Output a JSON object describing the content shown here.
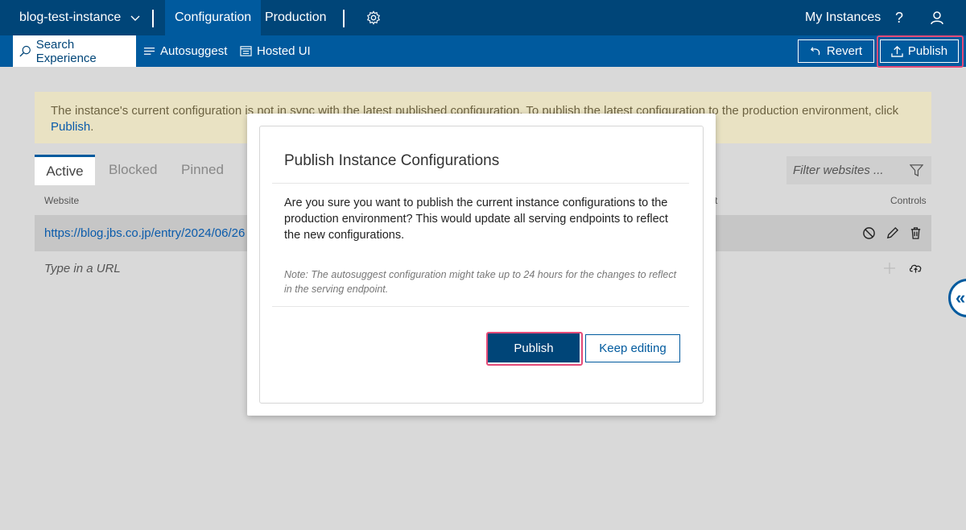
{
  "topbar": {
    "instance_name": "blog-test-instance",
    "tabs": [
      "Configuration",
      "Production"
    ],
    "my_instances": "My Instances",
    "help": "?"
  },
  "subbar": {
    "tabs": [
      "Search Experience",
      "Autosuggest",
      "Hosted UI"
    ],
    "revert_label": "Revert",
    "publish_label": "Publish"
  },
  "banner": {
    "text": "The instance's current configuration is not in sync with the latest published configuration. To publish the latest configuration to the production environment, click",
    "link": "Publish",
    "suffix": "."
  },
  "list": {
    "tabs": [
      "Active",
      "Blocked",
      "Pinned"
    ],
    "filter_placeholder": "Filter websites ...",
    "col_website": "Website",
    "col_right_partial": "t",
    "col_controls": "Controls",
    "rows": [
      {
        "url": "https://blog.jbs.co.jp/entry/2024/06/26"
      }
    ],
    "type_placeholder": "Type in a URL",
    "side_glyph": "«"
  },
  "dialog": {
    "title": "Publish Instance Configurations",
    "body": "Are you sure you want to publish the current instance configurations to the production environment? This would update all serving endpoints to reflect the new configurations.",
    "note": "Note: The autosuggest configuration might take up to 24 hours for the changes to reflect in the serving endpoint.",
    "publish_button": "Publish",
    "keep_editing_button": "Keep editing"
  },
  "colors": {
    "topbar": "#004578",
    "subbar": "#005a9e",
    "highlight": "#e54b78",
    "banner": "#e9e2c3"
  }
}
